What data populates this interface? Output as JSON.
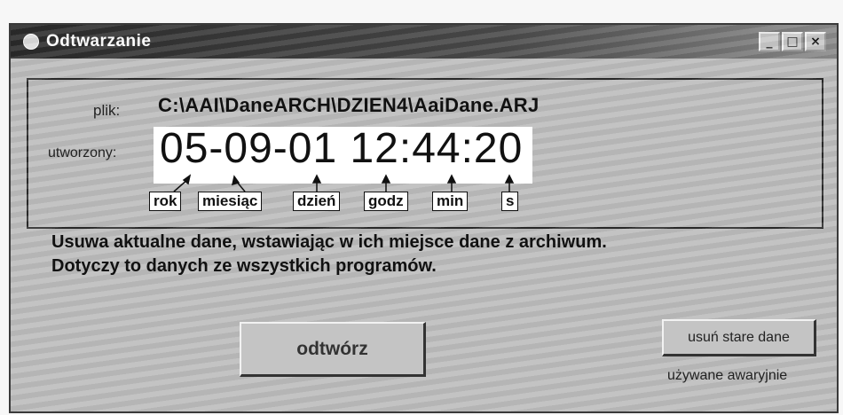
{
  "window": {
    "title": "Odtwarzanie",
    "minimize": "_",
    "maximize": "□",
    "close": "×"
  },
  "file": {
    "label": "plik:",
    "path": "C:\\AAI\\DaneARCH\\DZIEN4\\AaiDane.ARJ"
  },
  "created": {
    "label": "utworzony:",
    "datetime": "05-09-01 12:44:20",
    "parts": [
      "rok",
      "miesiąc",
      "dzień",
      "godz",
      "min",
      "s"
    ]
  },
  "description": "Usuwa aktualne dane, wstawiając w ich miejsce dane z archiwum. Dotyczy to danych ze wszystkich programów.",
  "buttons": {
    "restore": "odtwórz",
    "delete_old": "usuń stare dane"
  },
  "emergency_note": "używane awaryjnie"
}
